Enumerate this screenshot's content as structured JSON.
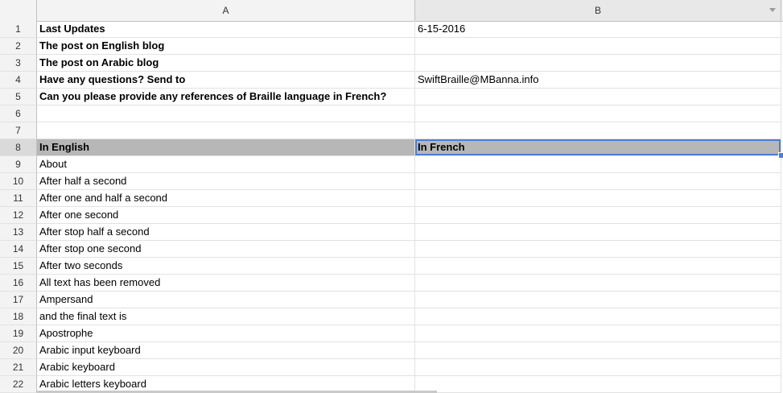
{
  "columns": {
    "a": "A",
    "b": "B"
  },
  "rows": [
    {
      "num": "1",
      "a": "Last Updates",
      "b": "6-15-2016",
      "bold_a": true
    },
    {
      "num": "2",
      "a": "The post on English blog",
      "b": "",
      "bold_a": true
    },
    {
      "num": "3",
      "a": "The post on Arabic blog",
      "b": "",
      "bold_a": true
    },
    {
      "num": "4",
      "a": "Have any questions? Send to",
      "b": "SwiftBraille@MBanna.info",
      "bold_a": true
    },
    {
      "num": "5",
      "a": "Can you please provide any references of Braille language in French?",
      "b": "",
      "bold_a": true
    },
    {
      "num": "6",
      "a": "",
      "b": ""
    },
    {
      "num": "7",
      "a": "",
      "b": ""
    },
    {
      "num": "8",
      "a": "In English",
      "b": "In French",
      "header": true
    },
    {
      "num": "9",
      "a": "About",
      "b": ""
    },
    {
      "num": "10",
      "a": "After half a second",
      "b": ""
    },
    {
      "num": "11",
      "a": "After one and half a second",
      "b": ""
    },
    {
      "num": "12",
      "a": "After one second",
      "b": ""
    },
    {
      "num": "13",
      "a": "After stop half a second",
      "b": ""
    },
    {
      "num": "14",
      "a": "After stop one second",
      "b": ""
    },
    {
      "num": "15",
      "a": "After two seconds",
      "b": ""
    },
    {
      "num": "16",
      "a": "All text has been removed",
      "b": ""
    },
    {
      "num": "17",
      "a": "Ampersand",
      "b": ""
    },
    {
      "num": "18",
      "a": "and the final text is",
      "b": ""
    },
    {
      "num": "19",
      "a": "Apostrophe",
      "b": ""
    },
    {
      "num": "20",
      "a": "Arabic input keyboard",
      "b": ""
    },
    {
      "num": "21",
      "a": "Arabic keyboard",
      "b": ""
    },
    {
      "num": "22",
      "a": "Arabic letters keyboard",
      "b": ""
    }
  ],
  "selection": {
    "cell": "B8",
    "color": "#4a7fd6"
  },
  "icons": {
    "column_menu": "chevron-down-icon"
  }
}
